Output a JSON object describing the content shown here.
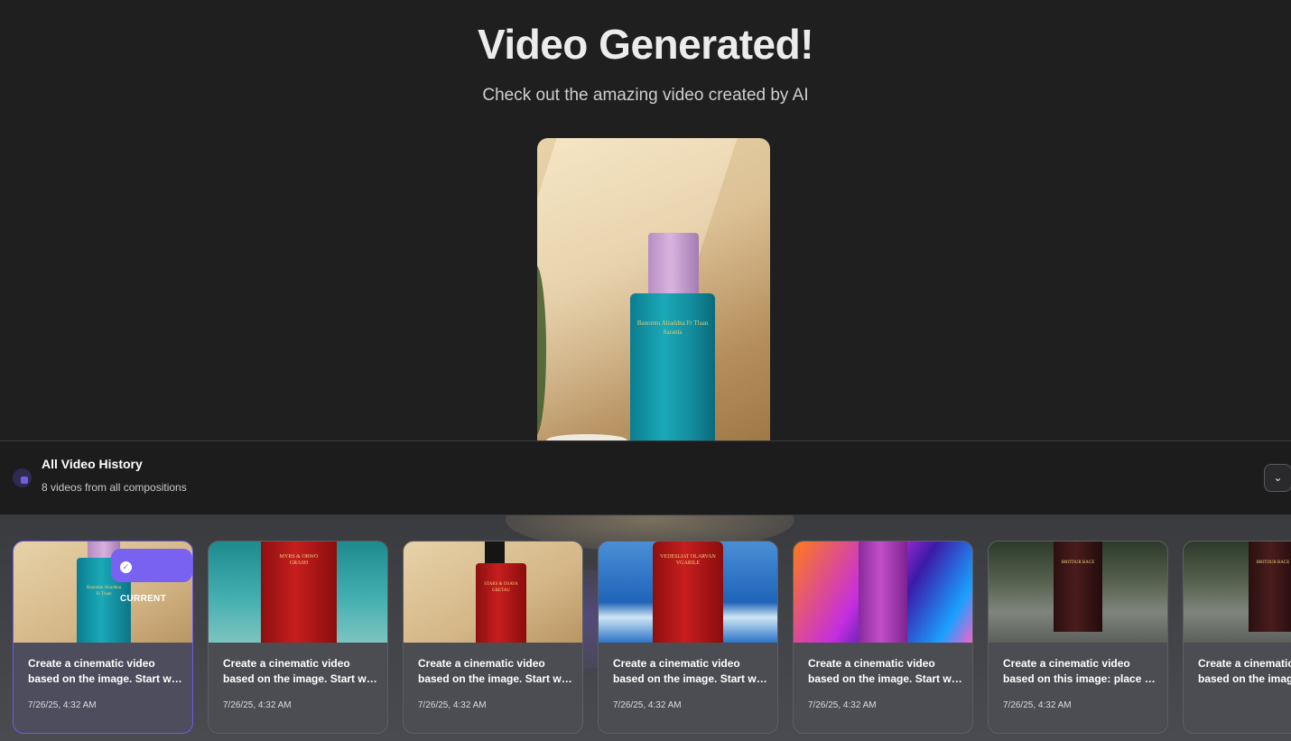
{
  "header": {
    "title": "Video Generated!",
    "subtitle": "Check out the amazing video created by AI"
  },
  "video_preview": {
    "bottle_label": "Banomtu Alraddna Fr Tlaan Saranla"
  },
  "history": {
    "title": "All Video History",
    "count_text": "8 videos from all compositions",
    "collapse_icon": "chevron-down-icon",
    "current_badge": "CURRENT",
    "accent_color": "#7a62f0",
    "cards": [
      {
        "line1": "Create a cinematic video",
        "line2": "based on the image. Start wit...",
        "date": "7/26/25, 4:32 AM",
        "current": true,
        "thumb": "teal-bottle-purple-cap-beige-wall"
      },
      {
        "line1": "Create a cinematic video",
        "line2": "based on the image. Start wit...",
        "date": "7/26/25, 4:32 AM",
        "current": false,
        "thumb": "red-bottle-underwater"
      },
      {
        "line1": "Create a cinematic video",
        "line2": "based on the image. Start wit...",
        "date": "7/26/25, 4:32 AM",
        "current": false,
        "thumb": "red-bottle-black-cap-beige-wall"
      },
      {
        "line1": "Create a cinematic video",
        "line2": "based on the image. Start wit...",
        "date": "7/26/25, 4:32 AM",
        "current": false,
        "thumb": "red-bottle-ocean-waves"
      },
      {
        "line1": "Create a cinematic video",
        "line2": "based on the image. Start wit...",
        "date": "7/26/25, 4:32 AM",
        "current": false,
        "thumb": "pink-bottle-neon-swirls"
      },
      {
        "line1": "Create a cinematic video",
        "line2": "based on this image: place th...",
        "date": "7/26/25, 4:32 AM",
        "current": false,
        "thumb": "dark-bottle-rainy-street"
      },
      {
        "line1": "Create a cinematic",
        "line2": "based on the image",
        "date": "",
        "current": false,
        "thumb": "dark-bottle-rainy-street"
      }
    ]
  }
}
